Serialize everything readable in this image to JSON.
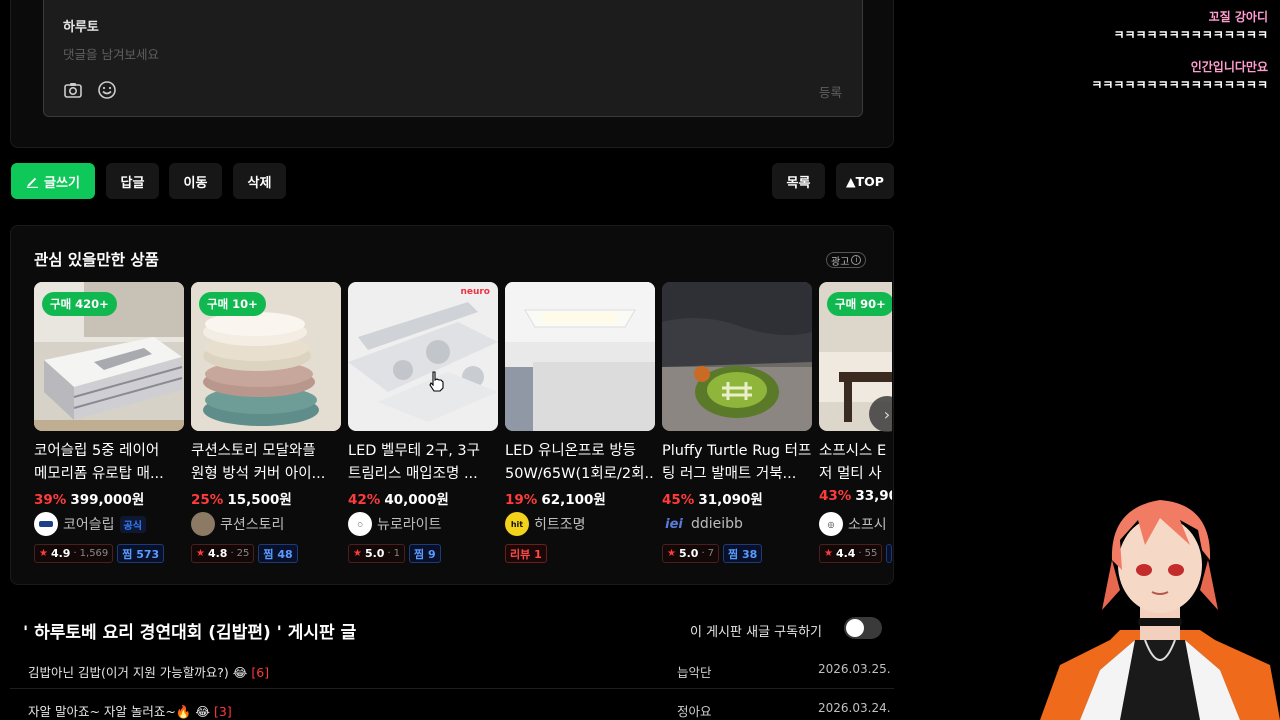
{
  "comment": {
    "author": "하루토",
    "placeholder": "댓글을 남겨보세요",
    "submit": "등록",
    "camera_icon": "camera-icon",
    "emoji_icon": "smiley-icon"
  },
  "actions": {
    "write": "글쓰기",
    "reply": "답글",
    "move": "이동",
    "delete": "삭제",
    "list": "목록",
    "top": "▲TOP"
  },
  "products": {
    "title": "관심 있을만한 상품",
    "ad_label": "광고",
    "items": [
      {
        "badge": "구매 420+",
        "name1": "코어슬립 5중 레이어",
        "name2": "메모리폼 유로탑 매...",
        "discount": "39%",
        "price": "399,000원",
        "seller": "코어슬립",
        "official": "공식",
        "rating": "4.9",
        "reviews": "1,569",
        "favs": "찜 573"
      },
      {
        "badge": "구매 10+",
        "name1": "쿠션스토리 모달와플",
        "name2": "원형 방석 커버 아이...",
        "discount": "25%",
        "price": "15,500원",
        "seller": "쿠션스토리",
        "official": "",
        "rating": "4.8",
        "reviews": "25",
        "favs": "찜 48"
      },
      {
        "badge": "",
        "name1": "LED 벨무테 2구, 3구",
        "name2": "트림리스 매입조명 ...",
        "discount": "42%",
        "price": "40,000원",
        "seller": "뉴로라이트",
        "official": "",
        "rating": "5.0",
        "reviews": "1",
        "favs": "찜 9",
        "brand_mark": "neuro"
      },
      {
        "badge": "",
        "name1": "LED 유니온프로 방등",
        "name2": "50W/65W(1회로/2회...",
        "discount": "19%",
        "price": "62,100원",
        "seller": "히트조명",
        "official": "",
        "review_only": "리뷰 1",
        "seller_logo_text": "hit"
      },
      {
        "badge": "",
        "name1": "Pluffy Turtle Rug 터프",
        "name2": "팅 러그 발매트 거북...",
        "discount": "45%",
        "price": "31,090원",
        "seller": "ddieibb",
        "official": "",
        "rating": "5.0",
        "reviews": "7",
        "favs": "찜 38",
        "seller_logo_text": "iei"
      },
      {
        "badge": "구매 90+",
        "name1": "소프시스 E",
        "name2": "저 멀티 사",
        "discount": "43%",
        "price": "33,90",
        "seller": "소프시",
        "official": "",
        "rating": "4.4",
        "reviews": "55",
        "favs": ""
      }
    ]
  },
  "board": {
    "title": "' 하루토베 요리 경연대회 (김밥편) ' 게시판 글",
    "subscribe_label": "이 게시판 새글 구독하기",
    "subscribed": false,
    "rows": [
      {
        "title": "김밥아닌 김밥(이거 지원 가능할까요?) 😂",
        "comments": "[6]",
        "author": "늡악단",
        "date": "2026.03.25."
      },
      {
        "title": "자알 말아죠~ 자알 놀러죠~🔥 😂",
        "comments": "[3]",
        "author": "정아요",
        "date": "2026.03.24."
      }
    ]
  },
  "chat": [
    {
      "name": "꼬질 강아디",
      "name_color": "#ff9ecf",
      "text": "ㅋㅋㅋㅋㅋㅋㅋㅋㅋㅋㅋㅋㅋㅋ"
    },
    {
      "name": "인간입니다만요",
      "name_color": "#ff9ecf",
      "text": "ㅋㅋㅋㅋㅋㅋㅋㅋㅋㅋㅋㅋㅋㅋㅋㅋ"
    }
  ],
  "colors": {
    "accent_green": "#0fc85a",
    "discount_red": "#ff3b3b",
    "fav_blue": "#5a9bff",
    "background": "#000000"
  }
}
